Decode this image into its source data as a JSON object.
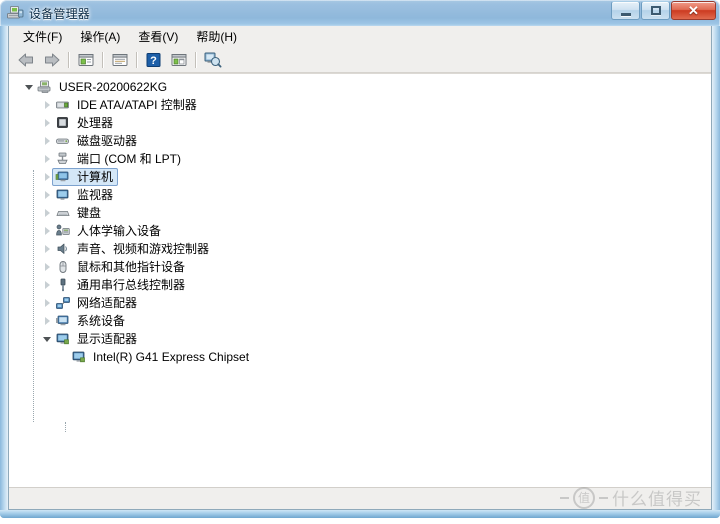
{
  "window": {
    "title": "设备管理器",
    "icon": "device-manager-icon",
    "buttons": {
      "minimize": "–",
      "maximize": "□",
      "close": "✕"
    }
  },
  "menu": {
    "items": [
      {
        "label": "文件(F)",
        "name": "menu-file"
      },
      {
        "label": "操作(A)",
        "name": "menu-action"
      },
      {
        "label": "查看(V)",
        "name": "menu-view"
      },
      {
        "label": "帮助(H)",
        "name": "menu-help"
      }
    ]
  },
  "toolbar": {
    "items": [
      {
        "name": "back-arrow-icon",
        "type": "button"
      },
      {
        "name": "forward-arrow-icon",
        "type": "button"
      },
      {
        "name": "separator-1",
        "type": "separator"
      },
      {
        "name": "show-hidden-icon",
        "type": "button"
      },
      {
        "name": "separator-2",
        "type": "separator"
      },
      {
        "name": "properties-icon",
        "type": "button"
      },
      {
        "name": "separator-3",
        "type": "separator"
      },
      {
        "name": "help-icon",
        "type": "button"
      },
      {
        "name": "update-driver-icon",
        "type": "button"
      },
      {
        "name": "separator-4",
        "type": "separator"
      },
      {
        "name": "scan-hardware-changes-icon",
        "type": "button"
      }
    ]
  },
  "tree": {
    "root": {
      "label": "USER-20200622KG",
      "icon": "computer-root-icon",
      "expanded": true
    },
    "nodes": [
      {
        "label": "IDE ATA/ATAPI 控制器",
        "icon": "ide-controller-icon",
        "expanded": false,
        "selected": false
      },
      {
        "label": "处理器",
        "icon": "processor-icon",
        "expanded": false,
        "selected": false
      },
      {
        "label": "磁盘驱动器",
        "icon": "disk-drive-icon",
        "expanded": false,
        "selected": false
      },
      {
        "label": "端口 (COM 和 LPT)",
        "icon": "ports-icon",
        "expanded": false,
        "selected": false
      },
      {
        "label": "计算机",
        "icon": "computer-icon",
        "expanded": false,
        "selected": true
      },
      {
        "label": "监视器",
        "icon": "monitor-icon",
        "expanded": false,
        "selected": false
      },
      {
        "label": "键盘",
        "icon": "keyboard-icon",
        "expanded": false,
        "selected": false
      },
      {
        "label": "人体学输入设备",
        "icon": "hid-icon",
        "expanded": false,
        "selected": false
      },
      {
        "label": "声音、视频和游戏控制器",
        "icon": "sound-controller-icon",
        "expanded": false,
        "selected": false
      },
      {
        "label": "鼠标和其他指针设备",
        "icon": "mouse-icon",
        "expanded": false,
        "selected": false
      },
      {
        "label": "通用串行总线控制器",
        "icon": "usb-controller-icon",
        "expanded": false,
        "selected": false
      },
      {
        "label": "网络适配器",
        "icon": "network-adapter-icon",
        "expanded": false,
        "selected": false
      },
      {
        "label": "系统设备",
        "icon": "system-device-icon",
        "expanded": false,
        "selected": false
      },
      {
        "label": "显示适配器",
        "icon": "display-adapter-icon",
        "expanded": true,
        "selected": false
      }
    ],
    "children": [
      {
        "parent": "显示适配器",
        "label": "Intel(R) G41 Express Chipset",
        "icon": "display-adapter-icon"
      }
    ]
  },
  "status_bar": {
    "text": ""
  },
  "watermark": {
    "symbol": "值",
    "text": "什么值得买"
  },
  "colors": {
    "accent": "#4a90c8",
    "selection_fill": "#d4e7f7",
    "selection_border": "#7da2ce",
    "close_button": "#cc3a20",
    "panel_bg": "#f0efed"
  }
}
